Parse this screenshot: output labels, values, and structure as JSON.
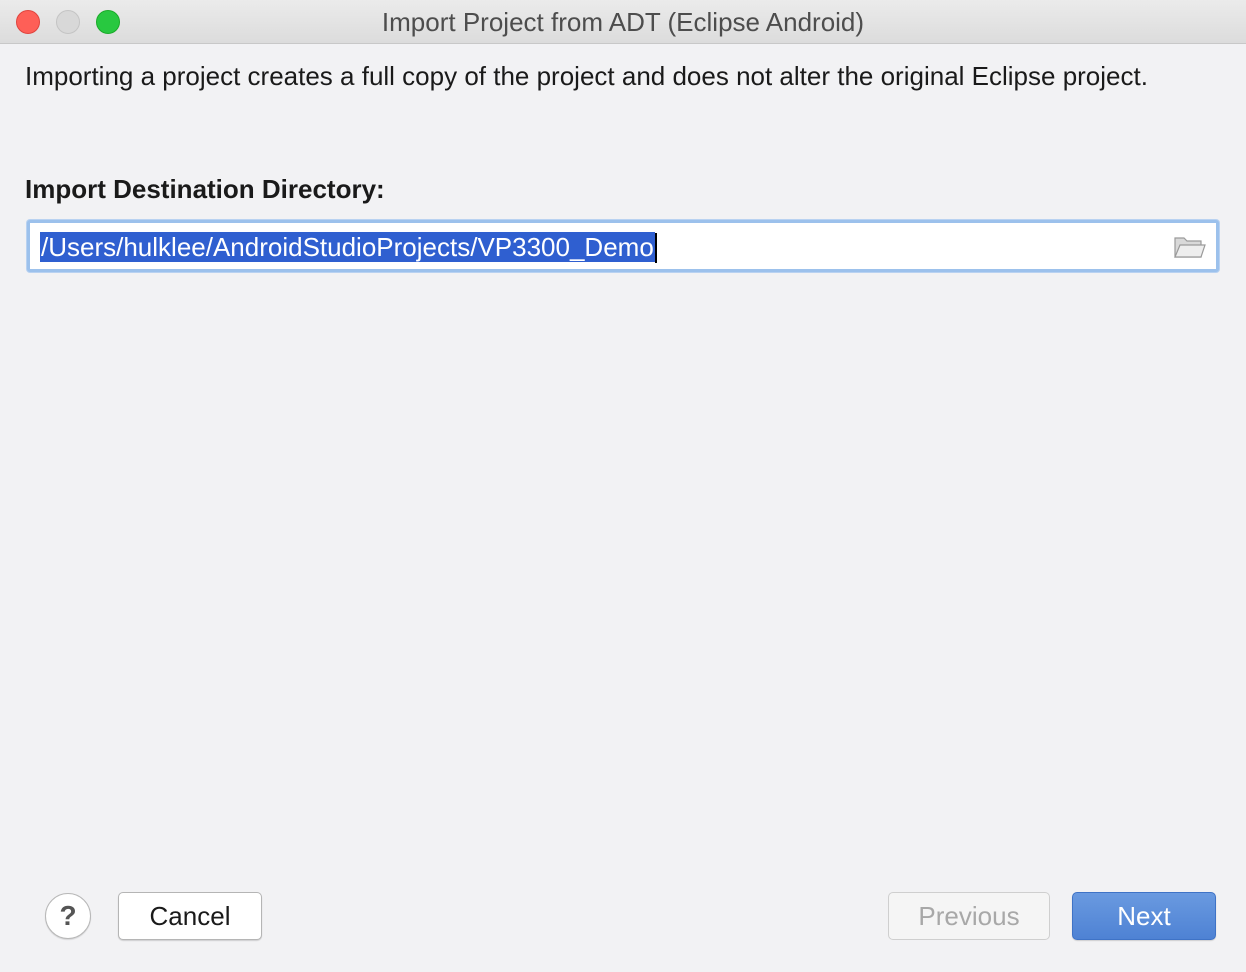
{
  "window": {
    "title": "Import Project from ADT (Eclipse Android)"
  },
  "content": {
    "description": "Importing a project creates a full copy of the project and does not alter the original Eclipse project.",
    "destination_label": "Import Destination Directory:",
    "destination_path": "/Users/hulklee/AndroidStudioProjects/VP3300_Demo",
    "browse_icon": "folder-icon"
  },
  "footer": {
    "help_label": "?",
    "cancel_label": "Cancel",
    "previous_label": "Previous",
    "next_label": "Next"
  },
  "colors": {
    "selection": "#2f5fd0",
    "primary_button": "#5a8ddb",
    "close": "#fe5f57",
    "maximize": "#28c840"
  }
}
